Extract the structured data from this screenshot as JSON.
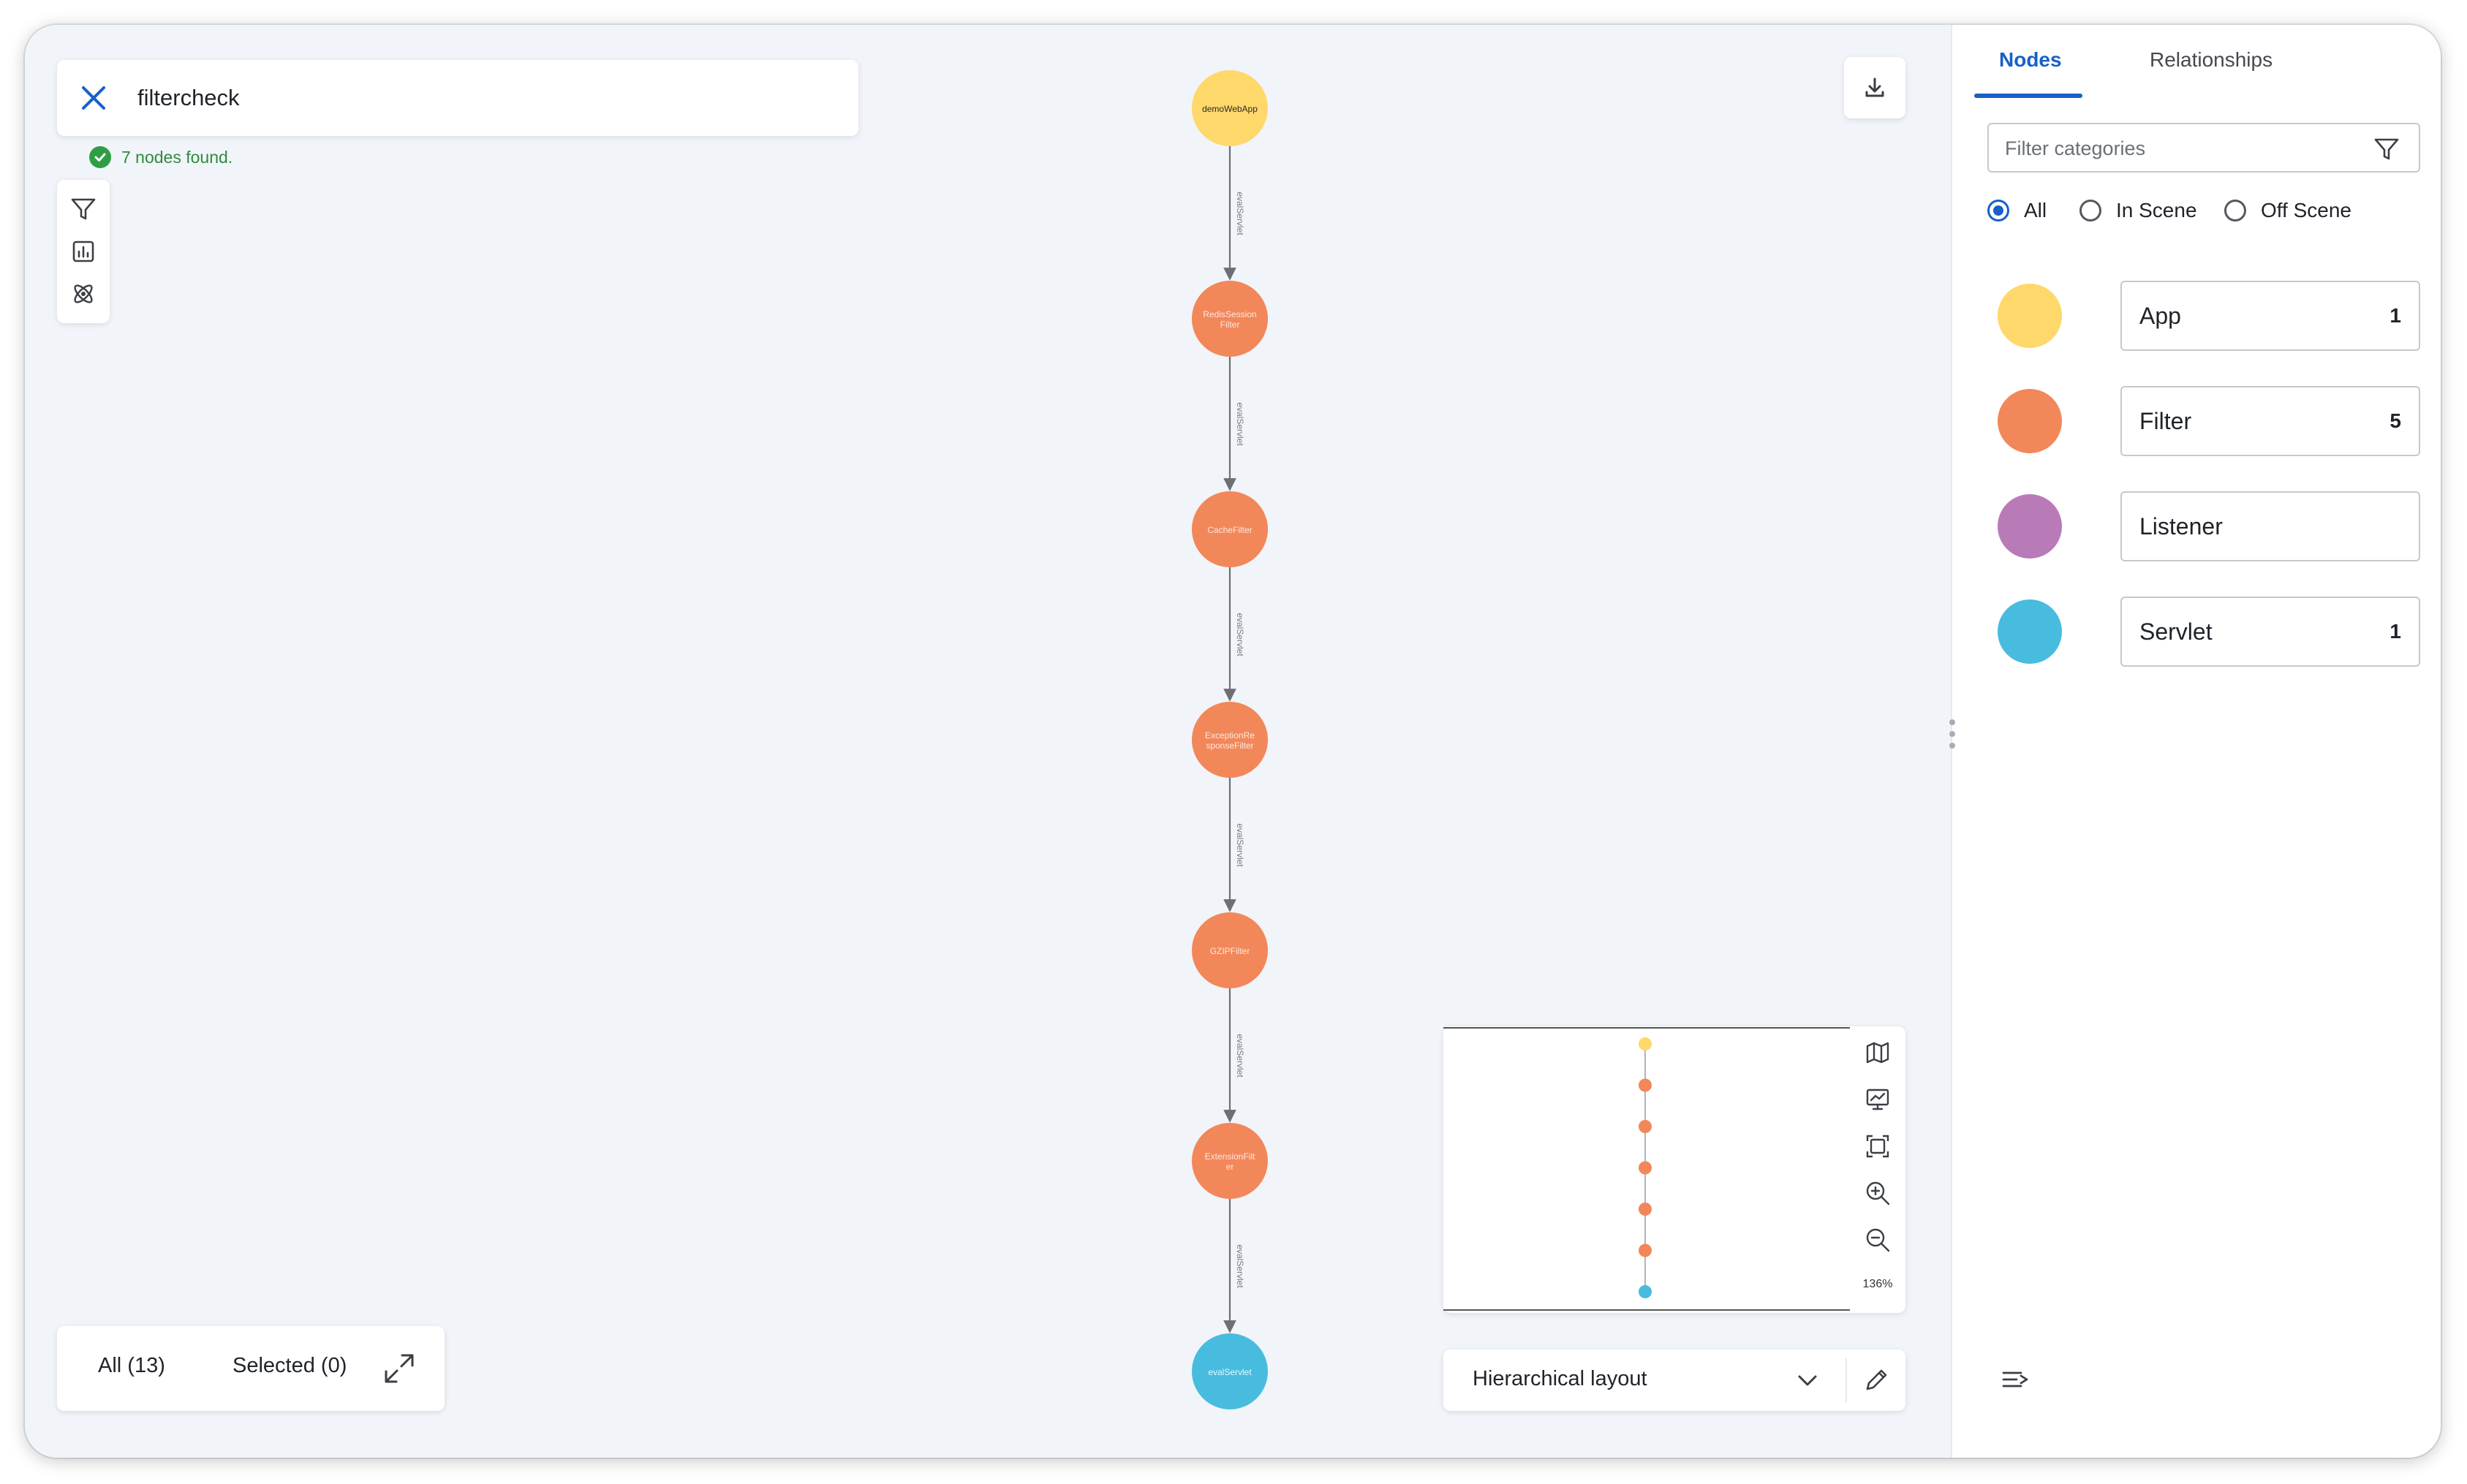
{
  "search": {
    "query": "filtercheck",
    "status": "7 nodes found."
  },
  "graph": {
    "nodes": [
      {
        "label": "demoWebApp",
        "category": "App"
      },
      {
        "label": "RedisSession Filter",
        "category": "Filter"
      },
      {
        "label": "CacheFilter",
        "category": "Filter"
      },
      {
        "label": "ExceptionRe sponseFilter",
        "category": "Filter"
      },
      {
        "label": "GZIPFilter",
        "category": "Filter"
      },
      {
        "label": "ExtensionFilt er",
        "category": "Filter"
      },
      {
        "label": "evalServlet",
        "category": "Servlet"
      }
    ],
    "edge_label": "evalServlet"
  },
  "minimap": {
    "zoom": "136%"
  },
  "layout": {
    "selected": "Hierarchical layout"
  },
  "counts": {
    "all": "All (13)",
    "selected": "Selected (0)"
  },
  "panel": {
    "tabs": [
      "Nodes",
      "Relationships"
    ],
    "active_tab": "Nodes",
    "filter_placeholder": "Filter categories",
    "radios": [
      {
        "label": "All",
        "checked": true
      },
      {
        "label": "In Scene",
        "checked": false
      },
      {
        "label": "Off Scene",
        "checked": false
      }
    ],
    "categories": [
      {
        "name": "App",
        "count": "1",
        "color": "#ffd86b"
      },
      {
        "name": "Filter",
        "count": "5",
        "color": "#f2875a"
      },
      {
        "name": "Listener",
        "count": "",
        "color": "#b87bb8"
      },
      {
        "name": "Servlet",
        "count": "1",
        "color": "#48bcdf"
      }
    ]
  },
  "icons": {
    "search_close": "close-icon",
    "toolbar": [
      "filter-icon",
      "bar-chart-icon",
      "atom-icon"
    ],
    "download": "download-icon",
    "minimap_tools": [
      "map-icon",
      "presentation-chart-icon",
      "fit-screen-icon",
      "zoom-in-icon",
      "zoom-out-icon"
    ],
    "layout": [
      "chevron-down-icon",
      "pencil-icon"
    ],
    "counts": "expand-icon",
    "panel": [
      "funnel-icon",
      "sort-lines-icon"
    ]
  }
}
